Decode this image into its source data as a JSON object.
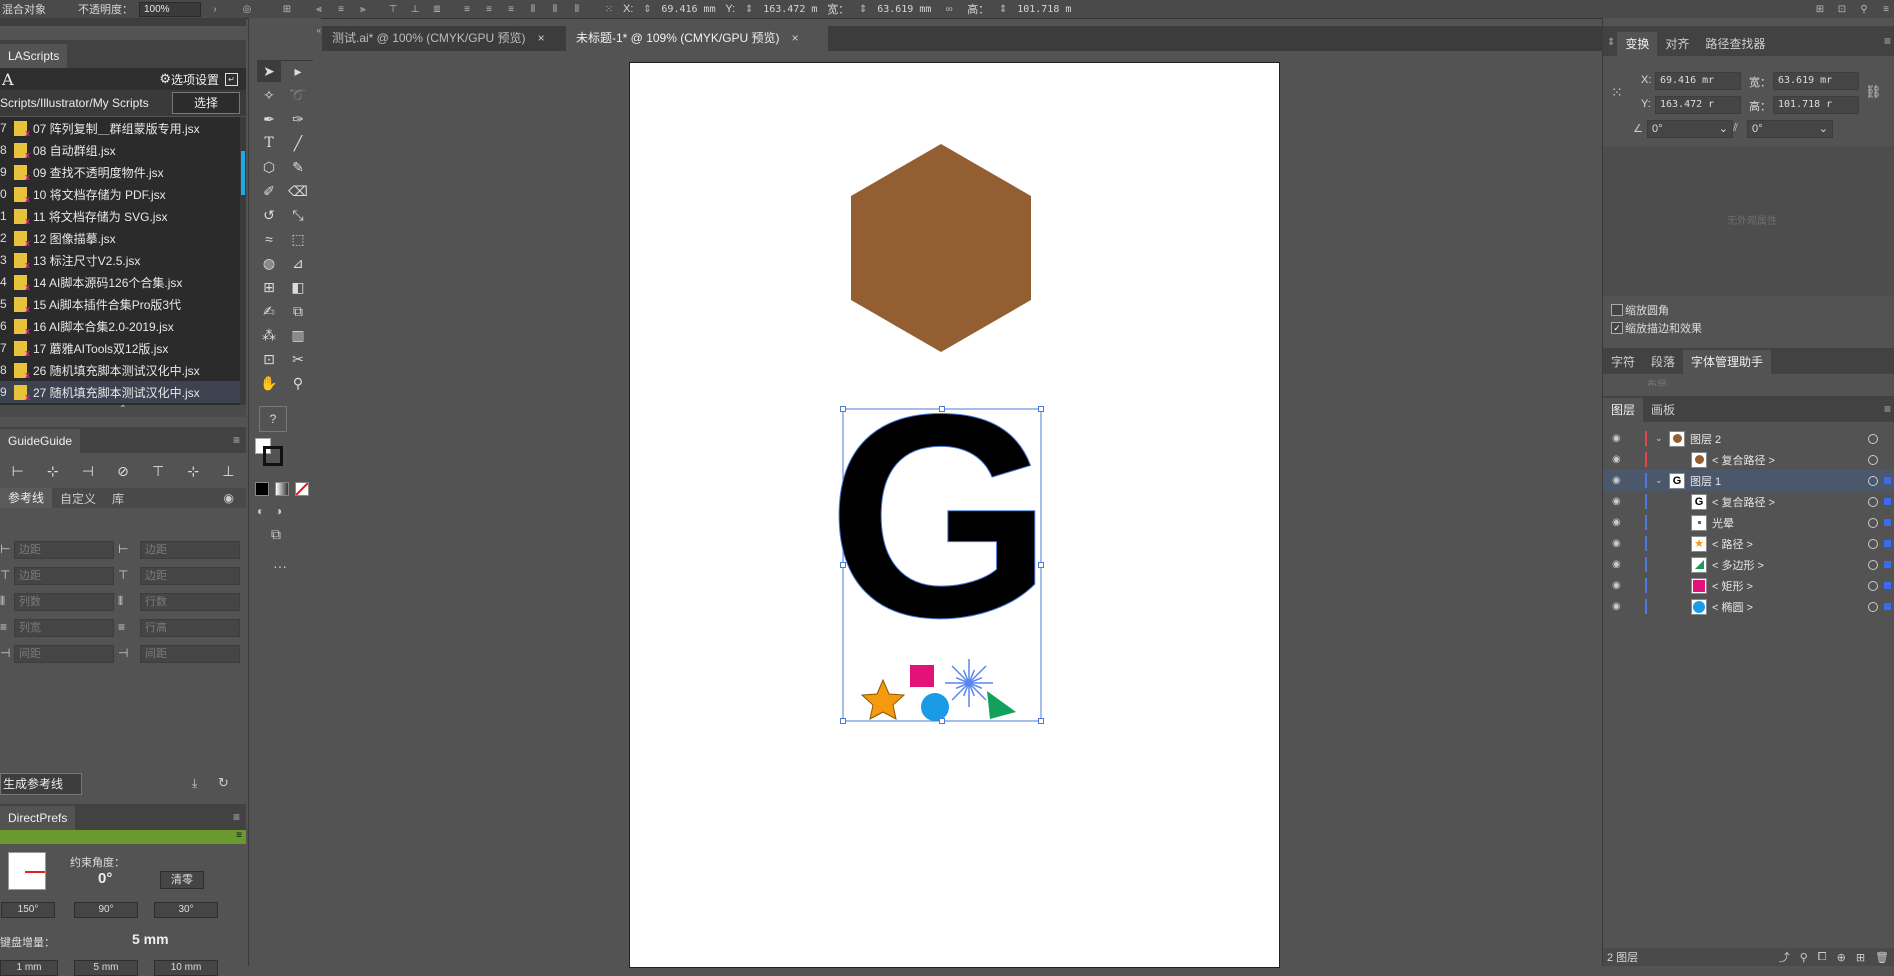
{
  "control_bar": {
    "object_type": "混合对象",
    "opacity_label": "不透明度：",
    "opacity_value": "100%",
    "x_label": "X:",
    "x_value": "69.416 mm",
    "y_label": "Y:",
    "y_value": "163.472 m",
    "w_label": "宽：",
    "w_value": "63.619 mm",
    "h_label": "高：",
    "h_value": "101.718 m"
  },
  "doc_tabs": [
    {
      "label": "测试.ai* @ 100% (CMYK/GPU 预览)",
      "close": "×"
    },
    {
      "label": "未标题-1* @ 109% (CMYK/GPU 预览)",
      "close": "×"
    }
  ],
  "lascripts": {
    "tab": "LAScripts",
    "logo": "A",
    "settings": "选项设置",
    "path": "Scripts/Illustrator/My Scripts",
    "choose": "选择",
    "items": [
      {
        "num": "7",
        "name": "07 阵列复制＿群组蒙版专用.jsx"
      },
      {
        "num": "8",
        "name": "08 自动群组.jsx"
      },
      {
        "num": "9",
        "name": "09 查找不透明度物件.jsx"
      },
      {
        "num": "0",
        "name": "10 将文档存储为 PDF.jsx"
      },
      {
        "num": "1",
        "name": "11 将文档存储为 SVG.jsx"
      },
      {
        "num": "2",
        "name": "12 图像描摹.jsx"
      },
      {
        "num": "3",
        "name": "13 标注尺寸V2.5.jsx"
      },
      {
        "num": "4",
        "name": "14 AI脚本源码126个合集.jsx"
      },
      {
        "num": "5",
        "name": "15 Ai脚本插件合集Pro版3代"
      },
      {
        "num": "6",
        "name": "16 AI脚本合集2.0-2019.jsx"
      },
      {
        "num": "7",
        "name": "17 蘑雅AITools双12版.jsx"
      },
      {
        "num": "8",
        "name": "26 随机填充脚本测试汉化中.jsx"
      },
      {
        "num": "9",
        "name": "27 随机填充脚本测试汉化中.jsx"
      }
    ]
  },
  "guideguide": {
    "tab": "GuideGuide",
    "subtabs": [
      "参考线",
      "自定义",
      "库"
    ],
    "fields": [
      "边距",
      "边距",
      "边距",
      "边距",
      "列数",
      "行数",
      "列宽",
      "行高",
      "间距",
      "间距"
    ],
    "generate": "生成参考线"
  },
  "directprefs": {
    "tab": "DirectPrefs",
    "angle_label": "约束角度：",
    "angle_value": "0°",
    "clear": "清零",
    "angles": [
      "150°",
      "90°",
      "30°"
    ],
    "key_label": "键盘增量：",
    "key_value": "5 mm",
    "increments": [
      "1 mm",
      "5 mm",
      "10 mm"
    ]
  },
  "transform_panel": {
    "tabs": [
      "变换",
      "对齐",
      "路径查找器"
    ],
    "x_label": "X:",
    "x_value": "69.416 mr",
    "w_label": "宽：",
    "w_value": "63.619 mr",
    "y_label": "Y:",
    "y_value": "163.472 r",
    "h_label": "高：",
    "h_value": "101.718 r",
    "rotate_value": "0°",
    "shear_value": "0°",
    "no_appearance": "无外观属性",
    "scale_corners": "缩放圆角",
    "scale_strokes": "缩放描边和效果"
  },
  "char_tabs": [
    "字符",
    "段落",
    "字体管理助手"
  ],
  "char_hint": "布局",
  "layers_panel": {
    "tabs": [
      "图层",
      "画板"
    ],
    "rows": [
      {
        "name": "图层 2",
        "indent": 0,
        "thumb": "hex"
      },
      {
        "name": "< 复合路径 >",
        "indent": 1,
        "thumb": "hex"
      },
      {
        "name": "图层 1",
        "indent": 0,
        "thumb": "G"
      },
      {
        "name": "< 复合路径 >",
        "indent": 1,
        "thumb": "G"
      },
      {
        "name": "光晕",
        "indent": 1,
        "thumb": "dot"
      },
      {
        "name": "< 路径 >",
        "indent": 1,
        "thumb": "star"
      },
      {
        "name": "< 多边形 >",
        "indent": 1,
        "thumb": "tri"
      },
      {
        "name": "< 矩形 >",
        "indent": 1,
        "thumb": "rect"
      },
      {
        "name": "< 椭圆 >",
        "indent": 1,
        "thumb": "ellipse"
      }
    ],
    "footer": "2 图层"
  },
  "canvas": {
    "glyph": "G",
    "colors": {
      "hexagon": "#935f32",
      "star": "#f59a0c",
      "rect": "#e3127b",
      "circle": "#1a9be6",
      "triangle": "#12a05a",
      "flare": "#5a86ee",
      "selection": "#4a7bd8"
    }
  },
  "toolbar": {
    "help": "?",
    "more": "···"
  }
}
